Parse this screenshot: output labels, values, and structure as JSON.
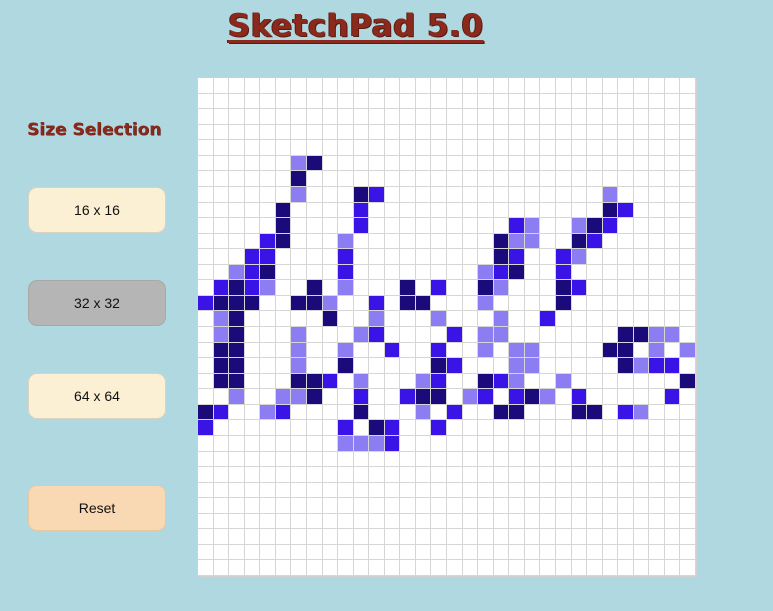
{
  "title": "SketchPad 5.0",
  "sidebar": {
    "heading": "Size Selection",
    "buttons": {
      "size16": "16 x 16",
      "size32": "32 x 32",
      "size64": "64 x 64",
      "reset": "Reset"
    },
    "selected_size": "32 x 32"
  },
  "canvas": {
    "grid_size": 32,
    "colors": {
      "background": "#ffffff",
      "gridline": "#d6d6d6",
      "dark": "#1a0a7a",
      "medium": "#3a14e6",
      "light": "#8d7df2"
    },
    "paint_rows": [
      "................................",
      "................................",
      "................................",
      "................................",
      "................................",
      "......31........................",
      "......1.........................",
      "......3...12..............3.....",
      ".....1....2...............12....",
      ".....1....2.........23..312.....",
      "....21...3.........133..12......",
      "...22....2.........12..23.......",
      "..321....2........321..2........",
      ".2123..1.3...1.2..13...12.......",
      "2111..113..2.11...3....1........",
      ".31.....1..3...3...3..2.........",
      ".31...3...32....2.33.......1133.1.3",
      ".11...3..3..2..2..3.33....11.3.3",
      ".11...3..1.....12...33.....1322.",
      ".11...112.3...32..123..3.......1",
      "..3..331..2..211.32.213.2.....2",
      "12..32....1...3.2..11...11.23..",
      "2........2.12..2...............",
      ".........3332...................",
      "................................",
      "................................",
      "................................",
      "................................",
      "................................",
      "................................",
      "................................",
      "................................"
    ]
  }
}
